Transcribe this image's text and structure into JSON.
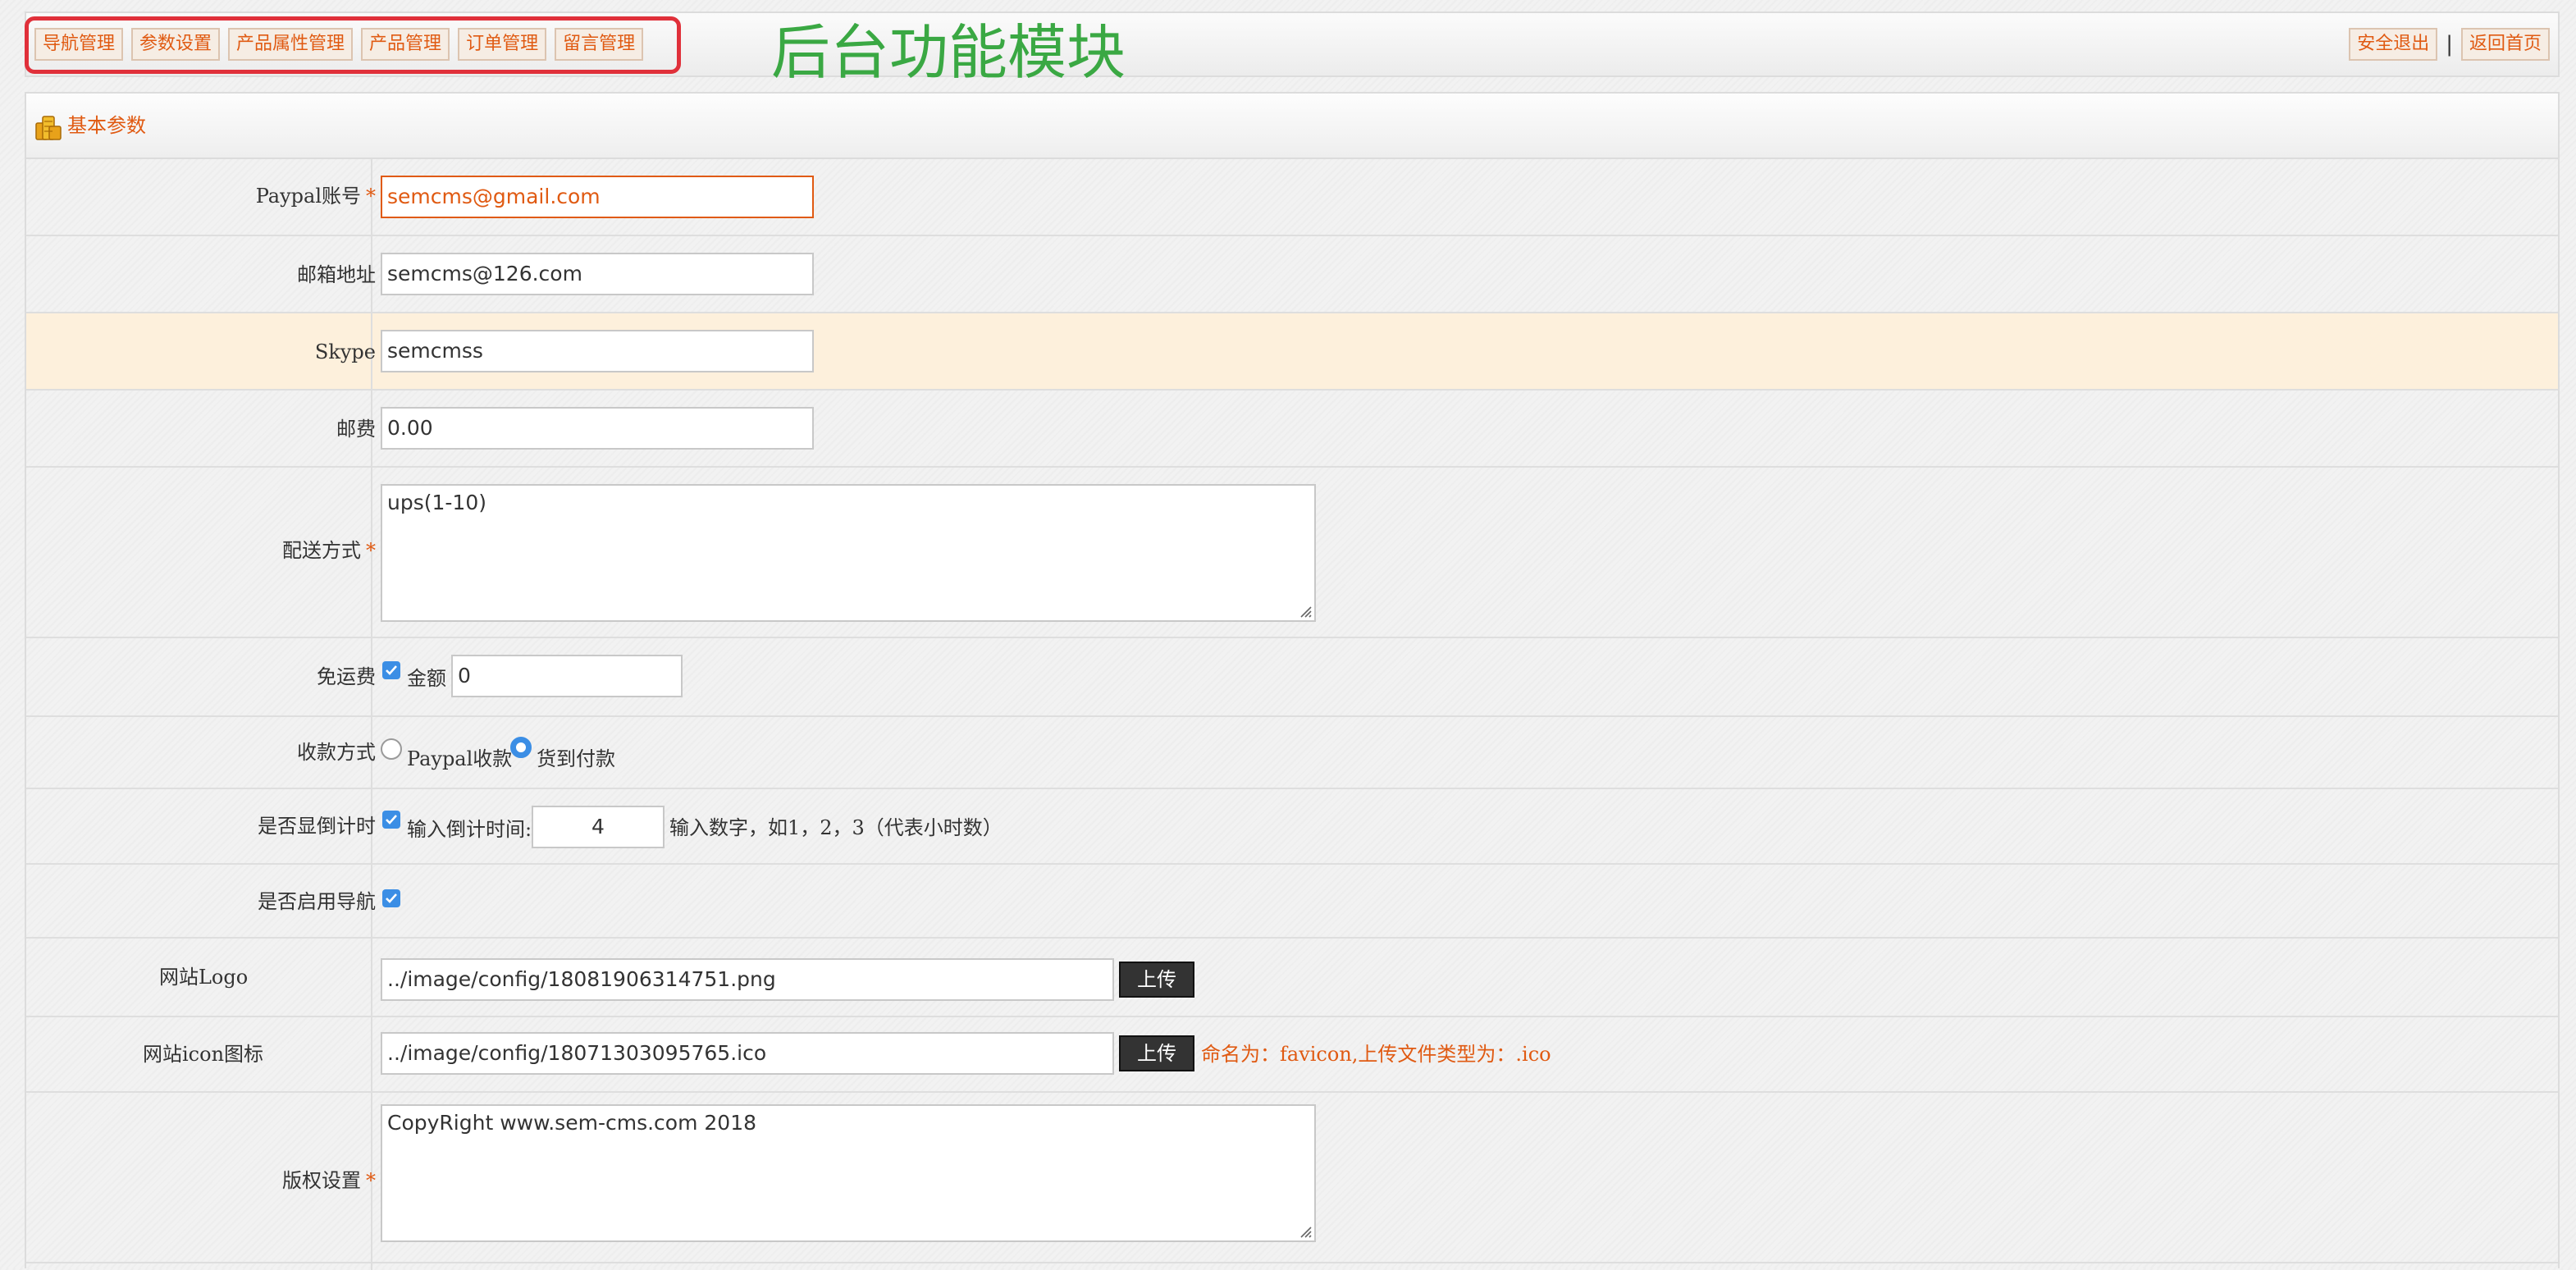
{
  "nav": {
    "items": [
      "导航管理",
      "参数设置",
      "产品属性管理",
      "产品管理",
      "订单管理",
      "留言管理"
    ],
    "annotation": "后台功能模块",
    "logout": "安全退出",
    "separator": "|",
    "home": "返回首页"
  },
  "panel": {
    "title": "基本参数"
  },
  "form": {
    "required_mark": "*",
    "paypal": {
      "label": "Paypal账号",
      "value": "semcms@gmail.com"
    },
    "email": {
      "label": "邮箱地址",
      "value": "semcms@126.com"
    },
    "skype": {
      "label": "Skype",
      "value": "semcmss"
    },
    "postage": {
      "label": "邮费",
      "value": "0.00"
    },
    "shipping": {
      "label": "配送方式",
      "value": "ups(1-10)"
    },
    "free_shipping": {
      "label": "免运费",
      "checked": true,
      "amount_label": "金额",
      "amount": "0"
    },
    "payment": {
      "label": "收款方式",
      "options": [
        "Paypal收款",
        "货到付款"
      ],
      "selected": "货到付款"
    },
    "countdown": {
      "label": "是否显倒计时",
      "checked": true,
      "input_label": "输入倒计时间:",
      "value": "4",
      "hint": "输入数字，如1，2，3（代表小时数）"
    },
    "enable_nav": {
      "label": "是否启用导航",
      "checked": true
    },
    "logo": {
      "label": "网站Logo",
      "value": "../image/config/18081906314751.png",
      "button": "上传"
    },
    "icon": {
      "label": "网站icon图标",
      "value": "../image/config/18071303095765.ico",
      "button": "上传",
      "hint": "命名为：favicon,上传文件类型为：.ico"
    },
    "copyright": {
      "label": "版权设置",
      "value": "CopyRight www.sem-cms.com 2018"
    }
  },
  "colors": {
    "accent": "#e05a12",
    "annotation": "#3aa843",
    "highlight_box": "#e0303a",
    "checkbox": "#3b8ee5",
    "row_highlight": "#fdf0dc"
  }
}
